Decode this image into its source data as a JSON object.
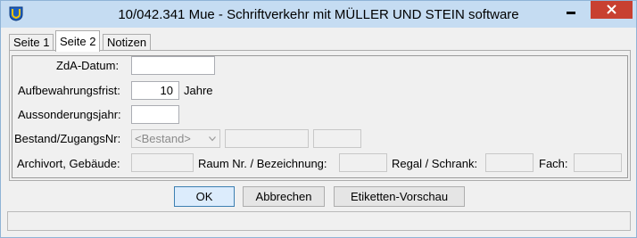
{
  "window": {
    "title": "10/042.341 Mue - Schriftverkehr mit MÜLLER UND STEIN software"
  },
  "tabs": [
    {
      "label": "Seite 1",
      "active": false
    },
    {
      "label": "Seite 2",
      "active": true
    },
    {
      "label": "Notizen",
      "active": false
    }
  ],
  "form": {
    "zda_datum_label": "ZdA-Datum:",
    "zda_datum_value": "",
    "aufbewahrungsfrist_label": "Aufbewahrungsfrist:",
    "aufbewahrungsfrist_value": "10",
    "aufbewahrungsfrist_unit": "Jahre",
    "aussonderungsjahr_label": "Aussonderungsjahr:",
    "aussonderungsjahr_value": "",
    "bestand_label": "Bestand/ZugangsNr:",
    "bestand_select_value": "<Bestand>",
    "archivort_label": "Archivort, Gebäude:",
    "raum_label": "Raum Nr. / Bezeichnung:",
    "regal_label": "Regal / Schrank:",
    "fach_label": "Fach:"
  },
  "buttons": {
    "ok": "OK",
    "abbrechen": "Abbrechen",
    "etiketten": "Etiketten-Vorschau"
  },
  "colors": {
    "titlebar": "#c5dcf2",
    "close_button": "#c84031",
    "default_button_border": "#3c7fb1"
  },
  "icons": {
    "app": "app-logo-icon",
    "minimize": "minimize-icon",
    "close": "close-icon",
    "dropdown": "chevron-down-icon"
  }
}
